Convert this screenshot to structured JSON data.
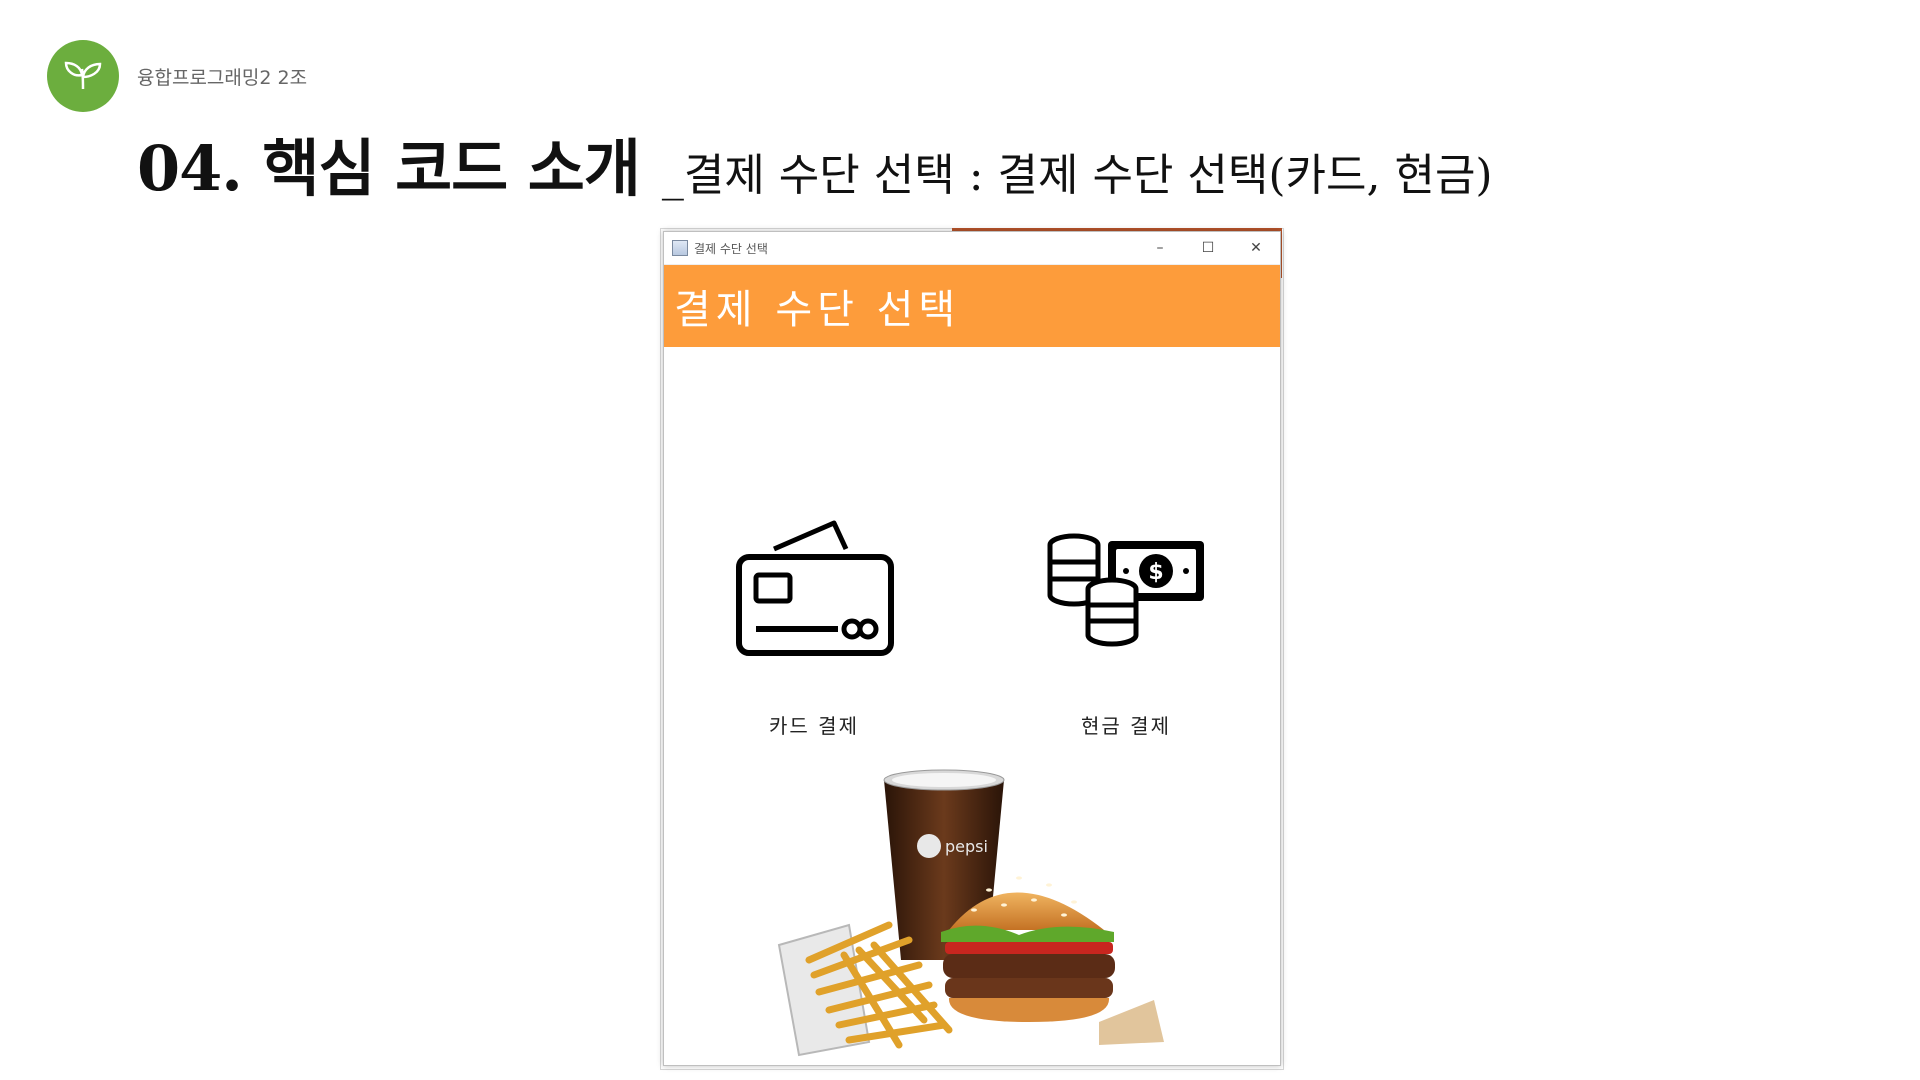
{
  "slide": {
    "team_label": "융합프로그래밍2 2조",
    "title_main": "04. 핵심 코드 소개",
    "title_sub": "_결제 수단 선택 : 결제 수단 선택(카드, 현금)"
  },
  "window": {
    "title": "결제 수단 선택",
    "controls": {
      "minimize": "–",
      "maximize": "☐",
      "close": "✕"
    },
    "header": "결제 수단 선택",
    "options": [
      {
        "label": "카드 결제",
        "icon": "credit-card-icon"
      },
      {
        "label": "현금 결제",
        "icon": "cash-coins-icon"
      }
    ],
    "image": {
      "cup_brand": "pepsi"
    }
  },
  "colors": {
    "logo": "#6cae3e",
    "header": "#fd9c3b",
    "header_text": "#ffffff"
  }
}
